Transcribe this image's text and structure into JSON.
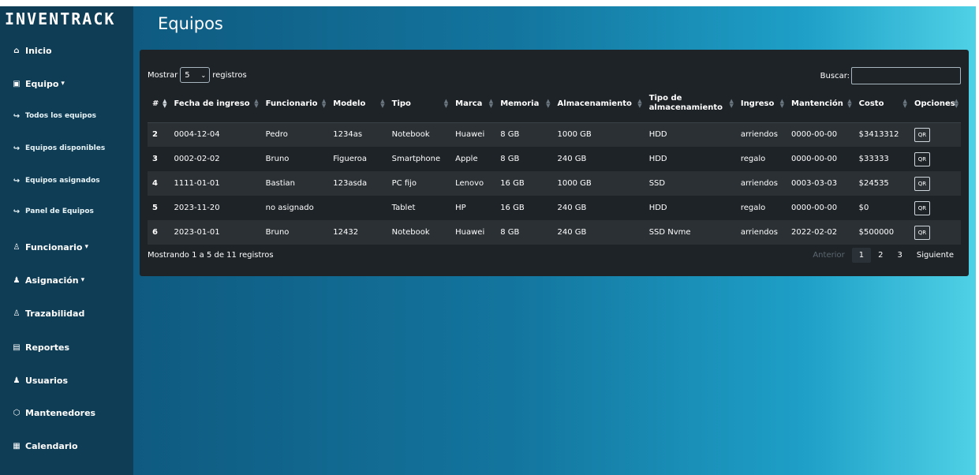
{
  "brand": "INVENTRACK",
  "page_title": "Equipos",
  "sidebar": {
    "items": [
      {
        "label": "Inicio",
        "icon": "home-icon",
        "glyph": "⌂",
        "caret": ""
      },
      {
        "label": "Equipo",
        "icon": "monitor-icon",
        "glyph": "▣",
        "caret": "▾"
      },
      {
        "label": "Todos los equipos",
        "icon": "sub-arrow-icon",
        "glyph": "↪",
        "caret": ""
      },
      {
        "label": "Equipos disponibles",
        "icon": "sub-arrow-icon",
        "glyph": "↪",
        "caret": ""
      },
      {
        "label": "Equipos asignados",
        "icon": "sub-arrow-icon",
        "glyph": "↪",
        "caret": ""
      },
      {
        "label": "Panel de Equipos",
        "icon": "sub-arrow-icon",
        "glyph": "↪",
        "caret": ""
      },
      {
        "label": "Funcionario",
        "icon": "user-icon",
        "glyph": "♙",
        "caret": "▾"
      },
      {
        "label": "Asignación",
        "icon": "user-assign-icon",
        "glyph": "♟",
        "caret": "▾"
      },
      {
        "label": "Trazabilidad",
        "icon": "users-icon",
        "glyph": "♙",
        "caret": ""
      },
      {
        "label": "Reportes",
        "icon": "file-icon",
        "glyph": "▤",
        "caret": ""
      },
      {
        "label": "Usuarios",
        "icon": "person-icon",
        "glyph": "♟",
        "caret": ""
      },
      {
        "label": "Mantenedores",
        "icon": "box-icon",
        "glyph": "⬡",
        "caret": ""
      },
      {
        "label": "Calendario",
        "icon": "calendar-icon",
        "glyph": "▦",
        "caret": ""
      }
    ]
  },
  "table_controls": {
    "show_label": "Mostrar",
    "length_value": "5",
    "records_label": "registros",
    "search_label": "Buscar:",
    "search_value": ""
  },
  "columns": [
    "#",
    "Fecha de ingreso",
    "Funcionario",
    "Modelo",
    "Tipo",
    "Marca",
    "Memoria",
    "Almacenamiento",
    "Tipo de almacenamiento",
    "Ingreso",
    "Mantención",
    "Costo",
    "Opciones"
  ],
  "rows": [
    [
      "2",
      "0004-12-04",
      "Pedro",
      "1234as",
      "Notebook",
      "Huawei",
      "8 GB",
      "1000 GB",
      "HDD",
      "arriendos",
      "0000-00-00",
      "$3413312",
      "QR"
    ],
    [
      "3",
      "0002-02-02",
      "Bruno",
      "Figueroa",
      "Smartphone",
      "Apple",
      "8 GB",
      "240 GB",
      "HDD",
      "regalo",
      "0000-00-00",
      "$33333",
      "QR"
    ],
    [
      "4",
      "1111-01-01",
      "Bastian",
      "123asda",
      "PC fijo",
      "Lenovo",
      "16 GB",
      "1000 GB",
      "SSD",
      "arriendos",
      "0003-03-03",
      "$24535",
      "QR"
    ],
    [
      "5",
      "2023-11-20",
      "no asignado",
      "",
      "Tablet",
      "HP",
      "16 GB",
      "240 GB",
      "HDD",
      "regalo",
      "0000-00-00",
      "$0",
      "QR"
    ],
    [
      "6",
      "2023-01-01",
      "Bruno",
      "12432",
      "Notebook",
      "Huawei",
      "8 GB",
      "240 GB",
      "SSD Nvme",
      "arriendos",
      "2022-02-02",
      "$500000",
      "QR"
    ]
  ],
  "info_text": "Mostrando 1 a 5 de 11 registros",
  "pagination": {
    "prev": "Anterior",
    "pages": [
      "1",
      "2",
      "3"
    ],
    "current": "1",
    "next": "Siguiente"
  }
}
